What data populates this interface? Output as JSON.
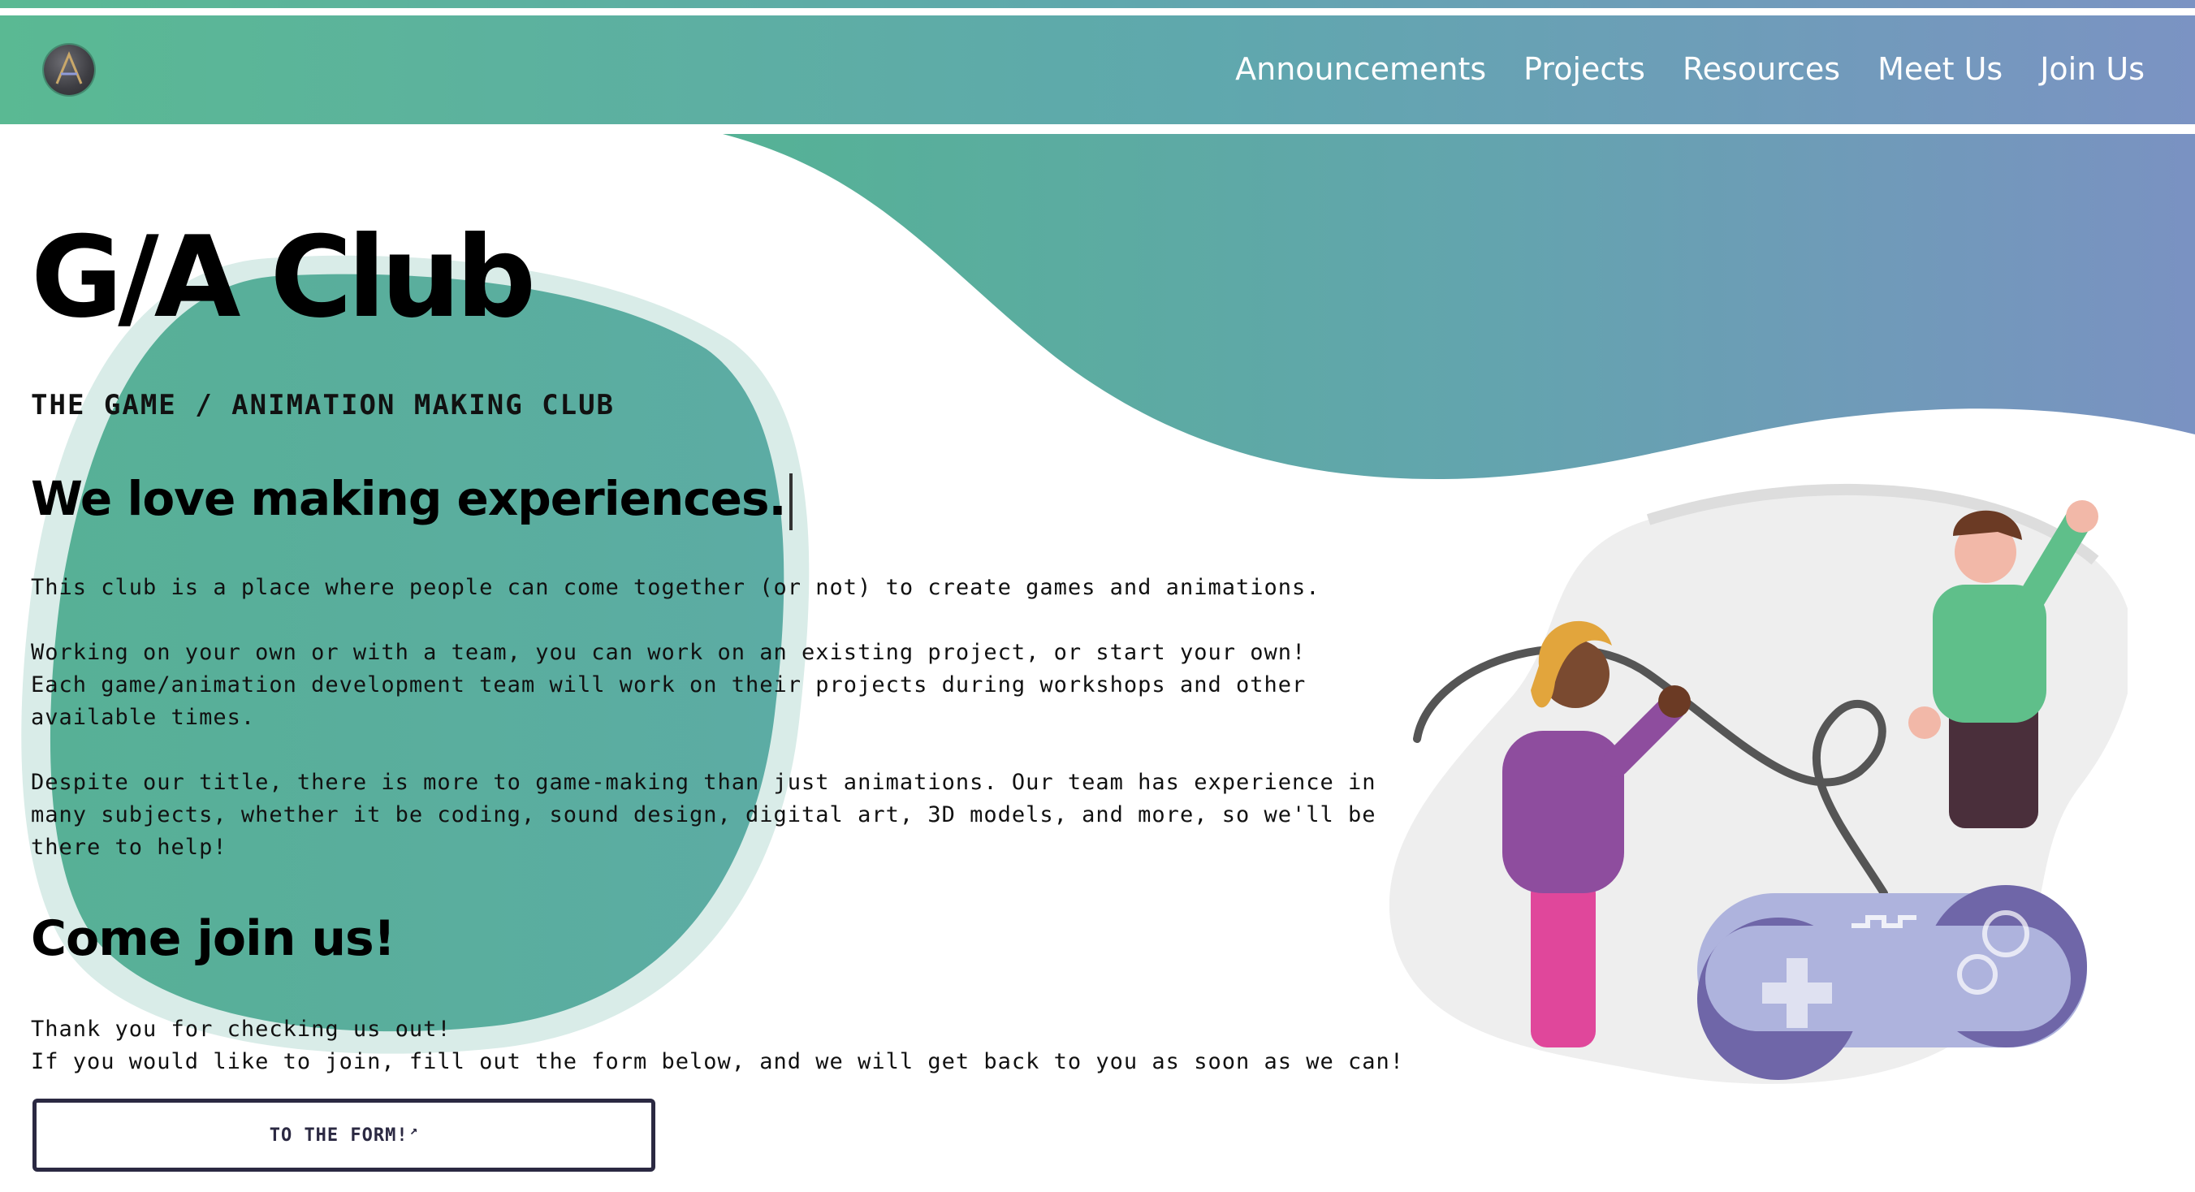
{
  "colors": {
    "gradient_start": "#5ab993",
    "gradient_mid": "#5fa8ad",
    "gradient_end": "#7b93c3",
    "blob": "#5aae9e",
    "button_border": "#2b2942"
  },
  "nav": {
    "logo_icon": "ga-logo-icon",
    "links": [
      "Announcements",
      "Projects",
      "Resources",
      "Meet Us",
      "Join Us"
    ]
  },
  "hero": {
    "title": "G/A Club",
    "subtitle": "THE GAME / ANIMATION MAKING CLUB",
    "heading": "We love making experiences.",
    "paragraphs": [
      [
        "This club is a place where people can come together (or not) to create games and animations."
      ],
      [
        "Working on your own or with a team, you can work on an existing project, or start your own!",
        "Each game/animation development team will work on their projects during workshops and other",
        "available times."
      ],
      [
        "Despite our title, there is more to game-making than just animations. Our team has experience in",
        "many subjects, whether it be coding, sound design, digital art, 3D models, and more, so we'll be",
        "there to help!"
      ]
    ],
    "join_heading": "Come join us!",
    "join_paragraph": [
      "Thank you for checking us out!",
      "If you would like to join, fill out the form below, and we will get back to you as soon as we can!"
    ],
    "form_button": "TO THE FORM!",
    "form_button_icon": "external-link-icon"
  },
  "illustration": {
    "description_icons": [
      "person-purple-jacket-icon",
      "person-green-shirt-icon",
      "game-controller-icon",
      "cable-icon"
    ]
  }
}
